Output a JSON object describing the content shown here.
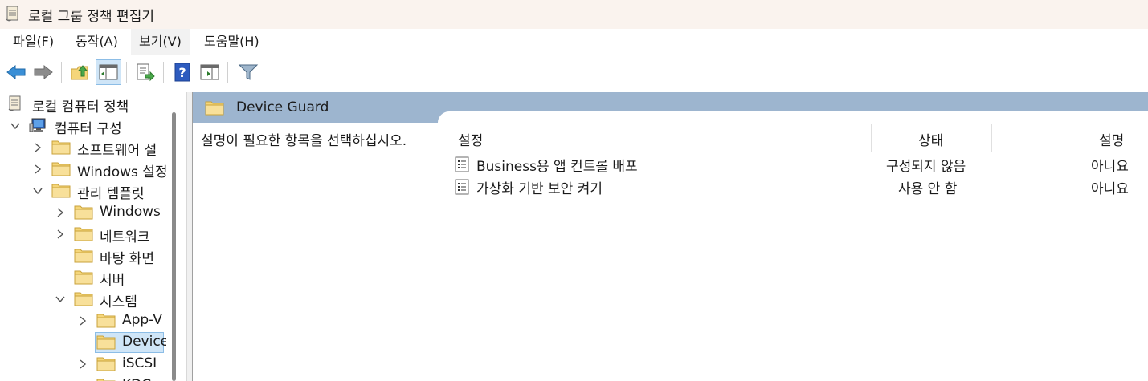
{
  "window": {
    "title": "로컬 그룹 정책 편집기"
  },
  "menu": [
    "파일(F)",
    "동작(A)",
    "보기(V)",
    "도움말(H)"
  ],
  "toolbar": {
    "buttons": [
      "back-icon",
      "forward-icon",
      "up-folder-icon",
      "show-hide-tree-icon",
      "export-list-icon",
      "help-icon",
      "show-hide-action-pane-icon",
      "filter-icon"
    ]
  },
  "tree": {
    "items": [
      {
        "label": "로컬 컴퓨터 정책",
        "level": 0,
        "expander": "none",
        "icon": "policy-icon"
      },
      {
        "label": "컴퓨터 구성",
        "level": 0,
        "expander": "expanded",
        "icon": "computer-icon"
      },
      {
        "label": "소프트웨어 설",
        "level": 1,
        "expander": "collapsed",
        "icon": "folder-icon"
      },
      {
        "label": "Windows 설정",
        "level": 1,
        "expander": "collapsed",
        "icon": "folder-icon"
      },
      {
        "label": "관리 템플릿",
        "level": 1,
        "expander": "expanded",
        "icon": "folder-icon"
      },
      {
        "label": "Windows",
        "level": 2,
        "expander": "collapsed",
        "icon": "folder-icon"
      },
      {
        "label": "네트워크",
        "level": 2,
        "expander": "collapsed",
        "icon": "folder-icon"
      },
      {
        "label": "바탕 화면",
        "level": 2,
        "expander": "none",
        "icon": "folder-icon"
      },
      {
        "label": "서버",
        "level": 2,
        "expander": "none",
        "icon": "folder-icon"
      },
      {
        "label": "시스템",
        "level": 2,
        "expander": "expanded",
        "icon": "folder-icon"
      },
      {
        "label": "App-V",
        "level": 3,
        "expander": "collapsed",
        "icon": "folder-icon"
      },
      {
        "label": "Device",
        "level": 3,
        "expander": "none",
        "icon": "folder-icon",
        "selected": true
      },
      {
        "label": "iSCSI",
        "level": 3,
        "expander": "collapsed",
        "icon": "folder-icon"
      },
      {
        "label": "KDC",
        "level": 3,
        "expander": "none",
        "icon": "folder-icon"
      }
    ]
  },
  "details": {
    "header_title": "Device Guard",
    "description": "설명이 필요한 항목을 선택하십시오.",
    "columns": {
      "setting": "설정",
      "state": "상태",
      "comment": "설명"
    },
    "rows": [
      {
        "name": "Business용 앱 컨트롤 배포",
        "state": "구성되지 않음",
        "comment": "아니요"
      },
      {
        "name": "가상화 기반 보안 켜기",
        "state": "사용 안 함",
        "comment": "아니요"
      }
    ]
  },
  "colors": {
    "header_band": "#9db5cf",
    "selection": "#cfe5f7",
    "selection_border": "#8cbde6",
    "folder": "#f5d67a"
  }
}
